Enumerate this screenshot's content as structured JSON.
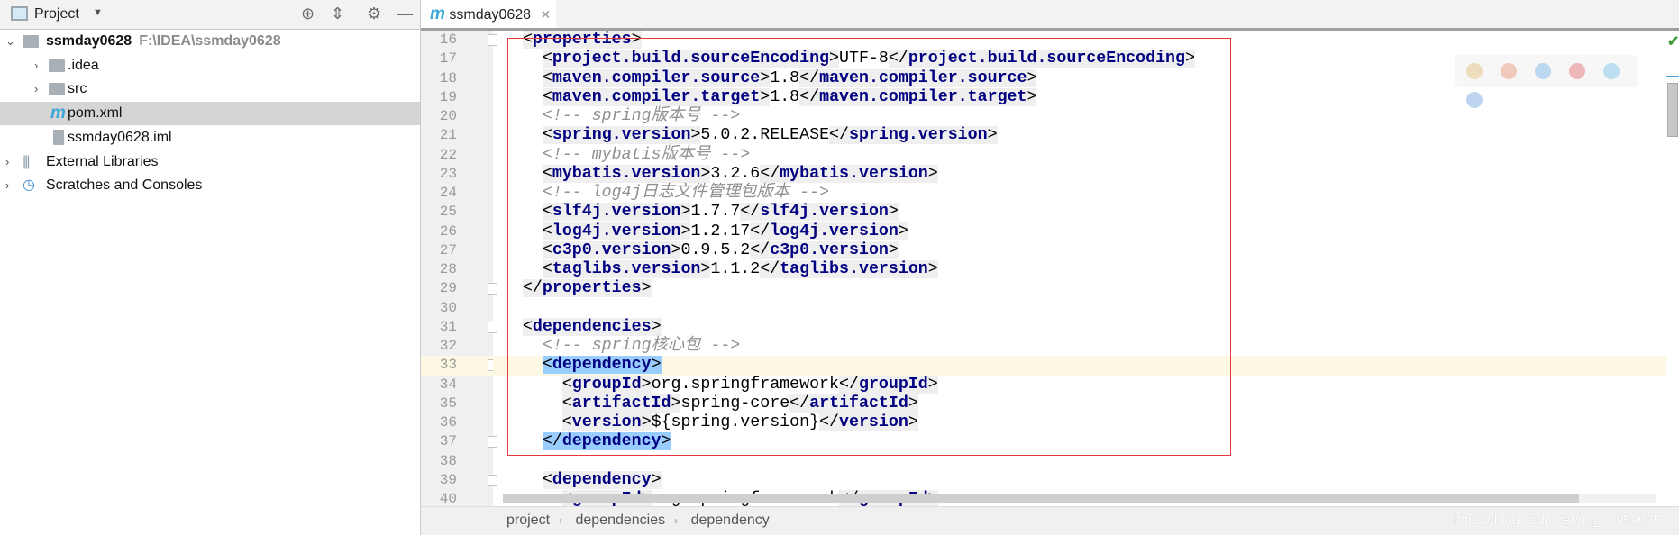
{
  "project_panel": {
    "title": "Project",
    "icons": [
      "locate-icon",
      "collapse-all-icon",
      "gear-icon",
      "minimize-icon"
    ],
    "tree": [
      {
        "label": "ssmday0628",
        "path": "F:\\IDEA\\ssmday0628",
        "level": 0,
        "expanded": true,
        "icon": "module-folder-icon",
        "bold": true
      },
      {
        "label": ".idea",
        "level": 1,
        "expanded": false,
        "icon": "folder-icon"
      },
      {
        "label": "src",
        "level": 1,
        "expanded": false,
        "icon": "folder-icon"
      },
      {
        "label": "pom.xml",
        "level": 1,
        "icon": "maven-icon",
        "selected": true
      },
      {
        "label": "ssmday0628.iml",
        "level": 1,
        "icon": "iml-file-icon"
      },
      {
        "label": "External Libraries",
        "level": 0,
        "expanded": false,
        "icon": "libraries-icon"
      },
      {
        "label": "Scratches and Consoles",
        "level": 0,
        "expanded": false,
        "icon": "scratches-icon"
      }
    ]
  },
  "editor": {
    "tab": {
      "label": "ssmday0628",
      "icon": "maven-icon"
    },
    "current_line": 33,
    "lines": [
      {
        "n": 16,
        "i": 0,
        "f": "open",
        "t": [
          [
            "tag",
            "properties"
          ]
        ]
      },
      {
        "n": 17,
        "i": 1,
        "t": [
          [
            "tag",
            "project.build.sourceEncoding"
          ],
          [
            "text",
            "UTF-8"
          ],
          [
            "ctag",
            "project.build.sourceEncoding"
          ]
        ]
      },
      {
        "n": 18,
        "i": 1,
        "t": [
          [
            "tag",
            "maven.compiler.source"
          ],
          [
            "text",
            "1.8"
          ],
          [
            "ctag",
            "maven.compiler.source"
          ]
        ]
      },
      {
        "n": 19,
        "i": 1,
        "t": [
          [
            "tag",
            "maven.compiler.target"
          ],
          [
            "text",
            "1.8"
          ],
          [
            "ctag",
            "maven.compiler.target"
          ]
        ]
      },
      {
        "n": 20,
        "i": 1,
        "t": [
          [
            "comment",
            "<!-- spring版本号 -->"
          ]
        ]
      },
      {
        "n": 21,
        "i": 1,
        "t": [
          [
            "tag",
            "spring.version"
          ],
          [
            "text",
            "5.0.2.RELEASE"
          ],
          [
            "ctag",
            "spring.version"
          ]
        ]
      },
      {
        "n": 22,
        "i": 1,
        "t": [
          [
            "comment",
            "<!-- mybatis版本号 -->"
          ]
        ]
      },
      {
        "n": 23,
        "i": 1,
        "t": [
          [
            "tag",
            "mybatis.version"
          ],
          [
            "text",
            "3.2.6"
          ],
          [
            "ctag",
            "mybatis.version"
          ]
        ]
      },
      {
        "n": 24,
        "i": 1,
        "t": [
          [
            "comment",
            "<!-- log4j日志文件管理包版本 -->"
          ]
        ]
      },
      {
        "n": 25,
        "i": 1,
        "t": [
          [
            "tag",
            "slf4j.version"
          ],
          [
            "text",
            "1.7.7"
          ],
          [
            "ctag",
            "slf4j.version"
          ]
        ]
      },
      {
        "n": 26,
        "i": 1,
        "t": [
          [
            "tag",
            "log4j.version"
          ],
          [
            "text",
            "1.2.17"
          ],
          [
            "ctag",
            "log4j.version"
          ]
        ]
      },
      {
        "n": 27,
        "i": 1,
        "t": [
          [
            "tag",
            "c3p0.version"
          ],
          [
            "text",
            "0.9.5.2"
          ],
          [
            "ctag",
            "c3p0.version"
          ]
        ]
      },
      {
        "n": 28,
        "i": 1,
        "t": [
          [
            "tag",
            "taglibs.version"
          ],
          [
            "text",
            "1.1.2"
          ],
          [
            "ctag",
            "taglibs.version"
          ]
        ]
      },
      {
        "n": 29,
        "i": 0,
        "f": "close",
        "t": [
          [
            "ctag",
            "properties"
          ]
        ]
      },
      {
        "n": 30,
        "i": 0,
        "t": []
      },
      {
        "n": 31,
        "i": 0,
        "f": "open",
        "t": [
          [
            "tag",
            "dependencies"
          ]
        ]
      },
      {
        "n": 32,
        "i": 1,
        "t": [
          [
            "comment",
            "<!-- spring核心包 -->"
          ]
        ]
      },
      {
        "n": 33,
        "i": 1,
        "f": "open",
        "t": [
          [
            "htag",
            "dependency"
          ]
        ]
      },
      {
        "n": 34,
        "i": 2,
        "t": [
          [
            "tag",
            "groupId"
          ],
          [
            "text",
            "org.springframework"
          ],
          [
            "ctag",
            "groupId"
          ]
        ]
      },
      {
        "n": 35,
        "i": 2,
        "t": [
          [
            "tag",
            "artifactId"
          ],
          [
            "text",
            "spring-core"
          ],
          [
            "ctag",
            "artifactId"
          ]
        ]
      },
      {
        "n": 36,
        "i": 2,
        "t": [
          [
            "tag",
            "version"
          ],
          [
            "text",
            "${spring.version}"
          ],
          [
            "ctag",
            "version"
          ]
        ]
      },
      {
        "n": 37,
        "i": 1,
        "f": "close",
        "t": [
          [
            "hctag",
            "dependency"
          ]
        ]
      },
      {
        "n": 38,
        "i": 0,
        "t": []
      },
      {
        "n": 39,
        "i": 1,
        "f": "open",
        "t": [
          [
            "tag",
            "dependency"
          ]
        ]
      },
      {
        "n": 40,
        "i": 2,
        "t": [
          [
            "tag",
            "groupId"
          ],
          [
            "text",
            "org.springframework"
          ],
          [
            "ctag",
            "groupId"
          ]
        ]
      }
    ]
  },
  "browser_icons": [
    "chrome-icon",
    "firefox-icon",
    "safari-icon",
    "opera-icon",
    "ie-icon",
    "edge-icon"
  ],
  "colors": {
    "tag": "#000080",
    "comment": "#909090",
    "highlight": "#99ccff",
    "annotation_box": "#e8383d"
  },
  "breadcrumb": [
    "project",
    "dependencies",
    "dependency"
  ],
  "watermark": "https://blog.csdn.net/qq_40959075"
}
